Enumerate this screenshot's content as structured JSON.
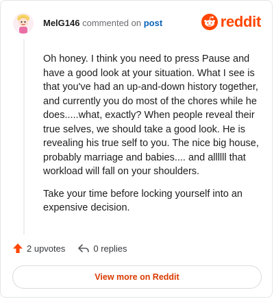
{
  "header": {
    "username": "MelG146",
    "action_text": "commented on",
    "post_link": "post",
    "avatar_icon": "snoo-avatar-icon"
  },
  "brand": {
    "icon": "reddit-snoo-icon",
    "wordmark": "reddit",
    "color": "#ff4500"
  },
  "comment": {
    "paragraphs": [
      "Oh honey. I think you need to press Pause and have a good look at your situation. What I see is that you've had an up-and-down history together, and currently you do most of the chores while he does.....what, exactly? When people reveal their true selves, we should take a good look. He is revealing his true self to you. The nice big house, probably marriage and babies.... and allllll that workload will fall on your shoulders.",
      "Take your time before locking yourself into an expensive decision."
    ]
  },
  "actions": {
    "upvotes": "2 upvotes",
    "upvote_icon": "upvote-arrow-icon",
    "replies": "0 replies",
    "reply_icon": "reply-arrow-icon"
  },
  "footer": {
    "view_more": "View more on Reddit"
  },
  "colors": {
    "accent": "#ff4500",
    "link": "#0b63b7",
    "view_more_text": "#d93a00"
  }
}
